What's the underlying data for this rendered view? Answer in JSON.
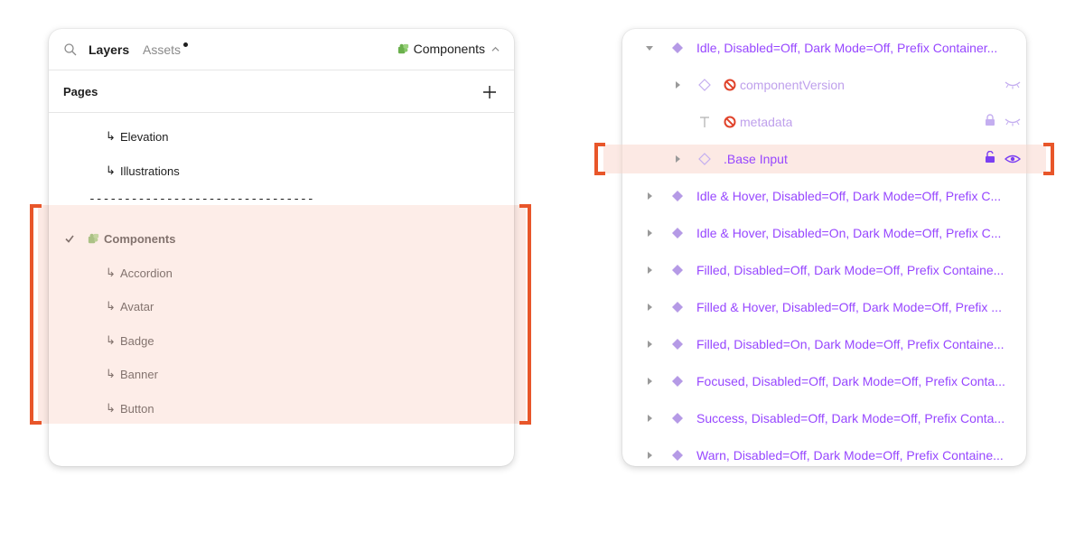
{
  "left_panel": {
    "tabs": {
      "layers": "Layers",
      "assets": "Assets"
    },
    "page_switcher": "Components",
    "pages_title": "Pages",
    "pages_before": [
      {
        "label": "Elevation"
      },
      {
        "label": "Illustrations"
      }
    ],
    "divider": "--------------------------------",
    "current_page": "Components",
    "subpages": [
      {
        "label": "Accordion"
      },
      {
        "label": "Avatar"
      },
      {
        "label": "Badge"
      },
      {
        "label": "Banner"
      },
      {
        "label": "Button"
      }
    ],
    "arrow_glyph": "↳"
  },
  "right_panel": {
    "top_row": "Idle, Disabled=Off, Dark Mode=Off, Prefix Container...",
    "children": [
      {
        "label": "componentVersion",
        "icon": "component-instance-icon"
      },
      {
        "label": "metadata",
        "icon": "text-icon"
      },
      {
        "label": ".Base Input",
        "icon": "component-instance-icon"
      }
    ],
    "variants": [
      "Idle & Hover, Disabled=Off, Dark Mode=Off, Prefix C...",
      "Idle & Hover, Disabled=On, Dark Mode=Off, Prefix C...",
      "Filled, Disabled=Off, Dark Mode=Off, Prefix Containe...",
      "Filled & Hover, Disabled=Off, Dark Mode=Off, Prefix ...",
      "Filled, Disabled=On, Dark Mode=Off, Prefix Containe...",
      "Focused, Disabled=Off, Dark Mode=Off, Prefix Conta...",
      "Success, Disabled=Off, Dark Mode=Off, Prefix Conta...",
      "Warn, Disabled=Off, Dark Mode=Off, Prefix Containe..."
    ]
  },
  "colors": {
    "accent_purple": "#9747ff",
    "highlight": "#fbe3db",
    "bracket": "#e8562a"
  }
}
